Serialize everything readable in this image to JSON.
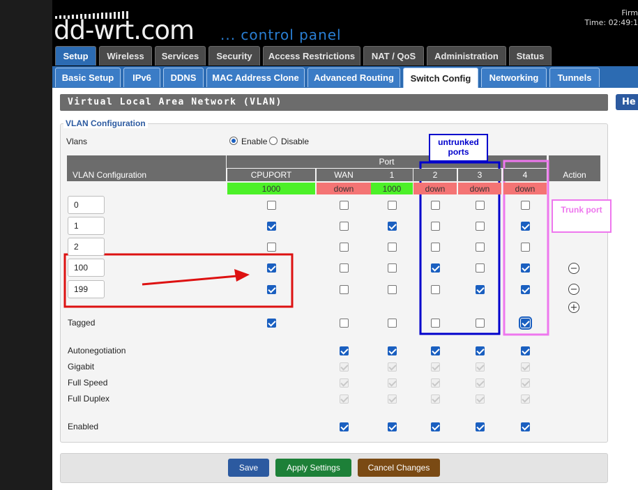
{
  "header": {
    "logo": "dd-wrt.com",
    "subtitle": "... control panel",
    "firmware_label": "Firm",
    "time_label": "Time: 02:49:1"
  },
  "main_tabs": [
    {
      "label": "Setup",
      "active": true
    },
    {
      "label": "Wireless"
    },
    {
      "label": "Services"
    },
    {
      "label": "Security"
    },
    {
      "label": "Access Restrictions"
    },
    {
      "label": "NAT / QoS"
    },
    {
      "label": "Administration"
    },
    {
      "label": "Status"
    }
  ],
  "sub_tabs": [
    {
      "label": "Basic Setup"
    },
    {
      "label": "IPv6"
    },
    {
      "label": "DDNS"
    },
    {
      "label": "MAC Address Clone"
    },
    {
      "label": "Advanced Routing"
    },
    {
      "label": "Switch Config",
      "active": true
    },
    {
      "label": "Networking"
    },
    {
      "label": "Tunnels"
    }
  ],
  "section_title": "Virtual Local Area Network (VLAN)",
  "help_label": "He",
  "fieldset_legend": "VLAN Configuration",
  "vlans": {
    "label": "Vlans",
    "enable_label": "Enable",
    "disable_label": "Disable",
    "selected": "Enable"
  },
  "table": {
    "config_header": "VLAN Configuration",
    "port_header": "Port",
    "action_header": "Action",
    "ports": [
      {
        "label": "CPUPORT",
        "status": "1000",
        "color": "#4cf028"
      },
      {
        "label": "WAN",
        "status": "down",
        "color": "#f47474"
      },
      {
        "label": "1",
        "status": "1000",
        "color": "#4cf028"
      },
      {
        "label": "2",
        "status": "down",
        "color": "#f47474"
      },
      {
        "label": "3",
        "status": "down",
        "color": "#f47474"
      },
      {
        "label": "4",
        "status": "down",
        "color": "#f47474"
      }
    ],
    "vlan_rows": [
      {
        "id": "0",
        "checks": [
          false,
          false,
          false,
          false,
          false,
          false
        ]
      },
      {
        "id": "1",
        "checks": [
          true,
          false,
          true,
          false,
          false,
          true
        ]
      },
      {
        "id": "2",
        "checks": [
          false,
          false,
          false,
          false,
          false,
          false
        ]
      },
      {
        "id": "100",
        "checks": [
          true,
          false,
          false,
          true,
          false,
          true
        ]
      },
      {
        "id": "199",
        "checks": [
          true,
          false,
          false,
          false,
          true,
          true
        ]
      }
    ],
    "tagged": {
      "label": "Tagged",
      "checks": [
        true,
        false,
        false,
        false,
        false,
        true
      ]
    },
    "settings": [
      {
        "label": "Autonegotiation",
        "checks": [
          true,
          true,
          true,
          true,
          true
        ],
        "disabled": false
      },
      {
        "label": "Gigabit",
        "checks": [
          true,
          true,
          true,
          true,
          true
        ],
        "disabled": true
      },
      {
        "label": "Full Speed",
        "checks": [
          true,
          true,
          true,
          true,
          true
        ],
        "disabled": true
      },
      {
        "label": "Full Duplex",
        "checks": [
          true,
          true,
          true,
          true,
          true
        ],
        "disabled": true
      },
      {
        "label": "Enabled",
        "checks": [
          true,
          true,
          true,
          true,
          true
        ],
        "disabled": false
      }
    ]
  },
  "annotations": {
    "untrunked": "untrunked ports",
    "trunk": "Trunk port",
    "untrunked_color": "#0000cc",
    "trunk_color": "#ee77ee",
    "highlight_color": "#dd1111"
  },
  "buttons": {
    "save": "Save",
    "apply": "Apply Settings",
    "cancel": "Cancel Changes"
  }
}
